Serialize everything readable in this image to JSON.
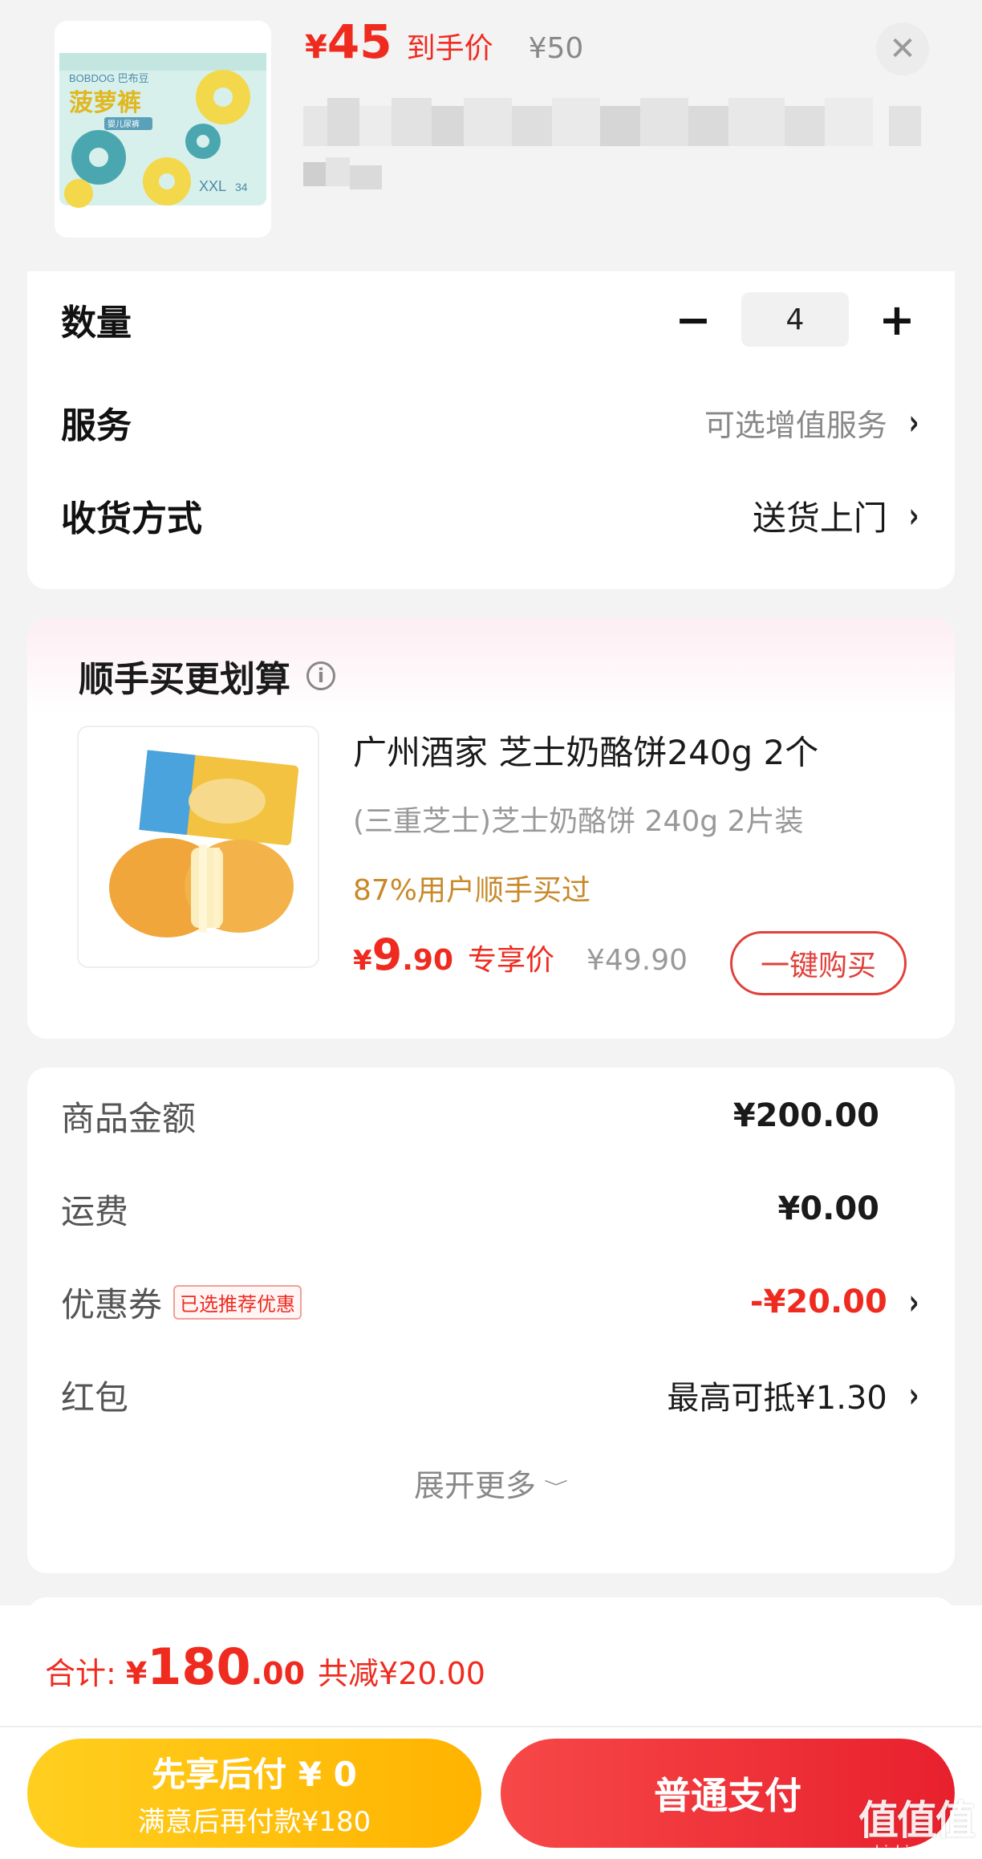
{
  "product": {
    "price_yen": "¥",
    "price_int": "45",
    "price_tag": "到手价",
    "price_original": "¥50",
    "close_icon": "close-icon",
    "image": {
      "brand": "BOBDOG 巴布豆",
      "name": "菠萝裤",
      "sub": "婴儿尿裤",
      "size": "XXL",
      "count": "34"
    }
  },
  "options": {
    "quantity_label": "数量",
    "quantity_value": "4",
    "minus_icon": "minus-icon",
    "plus_icon": "plus-icon",
    "service_label": "服务",
    "service_value": "可选增值服务",
    "delivery_label": "收货方式",
    "delivery_value": "送货上门",
    "chevron": "›"
  },
  "bundle": {
    "title": "顺手买更划算",
    "info_icon": "i",
    "name": "广州酒家 芝士奶酪饼240g 2个",
    "sub": "(三重芝士)芝士奶酪饼 240g 2片装",
    "stat": "87%用户顺手买过",
    "price_yen": "¥",
    "price_int": "9",
    "price_dec": ".90",
    "price_tag": "专享价",
    "price_original": "¥49.90",
    "buy_label": "一键购买"
  },
  "summary": {
    "goods_label": "商品金额",
    "goods_value": "¥200.00",
    "shipping_label": "运费",
    "shipping_value": "¥0.00",
    "coupon_label": "优惠券",
    "coupon_badge": "已选推荐优惠",
    "coupon_value": "-¥20.00",
    "redpacket_label": "红包",
    "redpacket_value": "最高可抵¥1.30",
    "expand_label": "展开更多"
  },
  "footer": {
    "total_label": "合计:",
    "total_yen": "¥",
    "total_int": "180",
    "total_dec": ".00",
    "total_saved": "共减¥20.00",
    "pay_later_main": "先享后付 ¥ 0",
    "pay_later_sub": "满意后再付款¥180",
    "pay_normal": "普通支付"
  },
  "watermark": {
    "main": "值值值",
    "sub": "zhizhizhi.com"
  },
  "colors": {
    "accent_red": "#ef2b20",
    "stat_gold": "#c8892a",
    "pay_later_yellow": "#ffb300",
    "pay_normal_red": "#e8202d"
  }
}
